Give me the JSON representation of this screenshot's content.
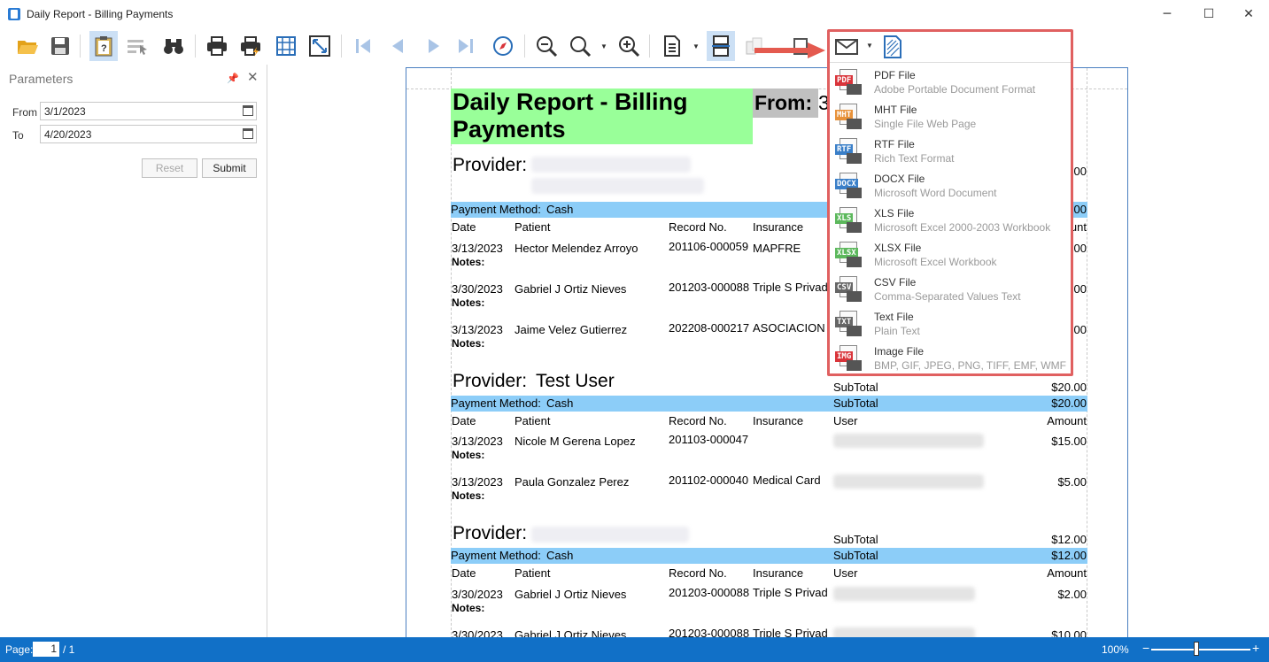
{
  "window": {
    "title": "Daily Report - Billing Payments",
    "minimize": "─",
    "maximize": "☐",
    "close": "✕"
  },
  "params": {
    "title": "Parameters",
    "from_label": "From",
    "from_value": "3/1/2023",
    "to_label": "To",
    "to_value": "4/20/2023",
    "reset_label": "Reset",
    "submit_label": "Submit"
  },
  "report": {
    "title": "Daily Report - Billing Payments",
    "from_label": "From:",
    "from_value": "3",
    "provider_label": "Provider:",
    "notes_label": "Notes:",
    "payment_method_label": "Payment Method:",
    "headers": {
      "date": "Date",
      "patient": "Patient",
      "record": "Record No.",
      "insurance": "Insurance",
      "user": "User",
      "amount": "Amount",
      "amount_partial": "ount"
    },
    "groups": [
      {
        "provider": "",
        "payment_method": "Cash",
        "bar_amount_partial": ".00",
        "subtotal_partial": ".00",
        "rows": [
          {
            "date": "3/13/2023",
            "patient": "Hector Melendez Arroyo",
            "record": "201106-000059",
            "insurance": "MAPFRE",
            "amount_partial": "00"
          },
          {
            "date": "3/30/2023",
            "patient": "Gabriel J Ortiz Nieves",
            "record": "201203-000088",
            "insurance": "Triple S Privad",
            "amount_partial": "00"
          },
          {
            "date": "3/13/2023",
            "patient": "Jaime Velez Gutierrez",
            "record": "202208-000217",
            "insurance": "ASOCIACION",
            "amount_partial": "00"
          }
        ]
      },
      {
        "provider": "Test User",
        "payment_method": "Cash",
        "subtotal_label": "SubTotal",
        "subtotal": "$20.00",
        "bar_subtotal": "$20.00",
        "rows": [
          {
            "date": "3/13/2023",
            "patient": "Nicole M Gerena Lopez",
            "record": "201103-000047",
            "insurance": "",
            "amount": "$15.00"
          },
          {
            "date": "3/13/2023",
            "patient": "Paula Gonzalez Perez",
            "record": "201102-000040",
            "insurance": "Medical Card",
            "amount": "$5.00"
          }
        ]
      },
      {
        "provider": "",
        "payment_method": "Cash",
        "subtotal_label": "SubTotal",
        "subtotal": "$12.00",
        "bar_subtotal": "$12.00",
        "rows": [
          {
            "date": "3/30/2023",
            "patient": "Gabriel J Ortiz Nieves",
            "record": "201203-000088",
            "insurance": "Triple S Privad",
            "amount": "$2.00"
          },
          {
            "date": "3/30/2023",
            "patient": "Gabriel J Ortiz Nieves",
            "record": "201203-000088",
            "insurance": "Triple S Privad",
            "amount": "$10.00"
          }
        ]
      }
    ]
  },
  "export_menu": {
    "items": [
      {
        "tag": "PDF",
        "color": "#d9343a",
        "title": "PDF File",
        "subtitle": "Adobe Portable Document Format"
      },
      {
        "tag": "MHT",
        "color": "#e8923a",
        "title": "MHT File",
        "subtitle": "Single File Web Page"
      },
      {
        "tag": "RTF",
        "color": "#3a7fc8",
        "title": "RTF File",
        "subtitle": "Rich Text Format"
      },
      {
        "tag": "DOCX",
        "color": "#3a7fc8",
        "title": "DOCX File",
        "subtitle": "Microsoft Word Document"
      },
      {
        "tag": "XLS",
        "color": "#5cb85c",
        "title": "XLS File",
        "subtitle": "Microsoft Excel 2000-2003 Workbook"
      },
      {
        "tag": "XLSX",
        "color": "#5cb85c",
        "title": "XLSX File",
        "subtitle": "Microsoft Excel Workbook"
      },
      {
        "tag": "CSV",
        "color": "#666666",
        "title": "CSV File",
        "subtitle": "Comma-Separated Values Text"
      },
      {
        "tag": "TXT",
        "color": "#666666",
        "title": "Text File",
        "subtitle": "Plain Text"
      },
      {
        "tag": "IMG",
        "color": "#d9343a",
        "title": "Image File",
        "subtitle": "BMP, GIF, JPEG, PNG, TIFF, EMF, WMF"
      }
    ]
  },
  "status": {
    "page_label": "Page:",
    "page_value": "1",
    "page_total": "/ 1",
    "zoom": "100%",
    "zoom_minus": "−",
    "zoom_plus": "+"
  },
  "colors": {
    "accent": "#1170c7",
    "title_highlight": "#99ff99",
    "row_bar": "#8ccdf8",
    "callout": "#e06060"
  }
}
